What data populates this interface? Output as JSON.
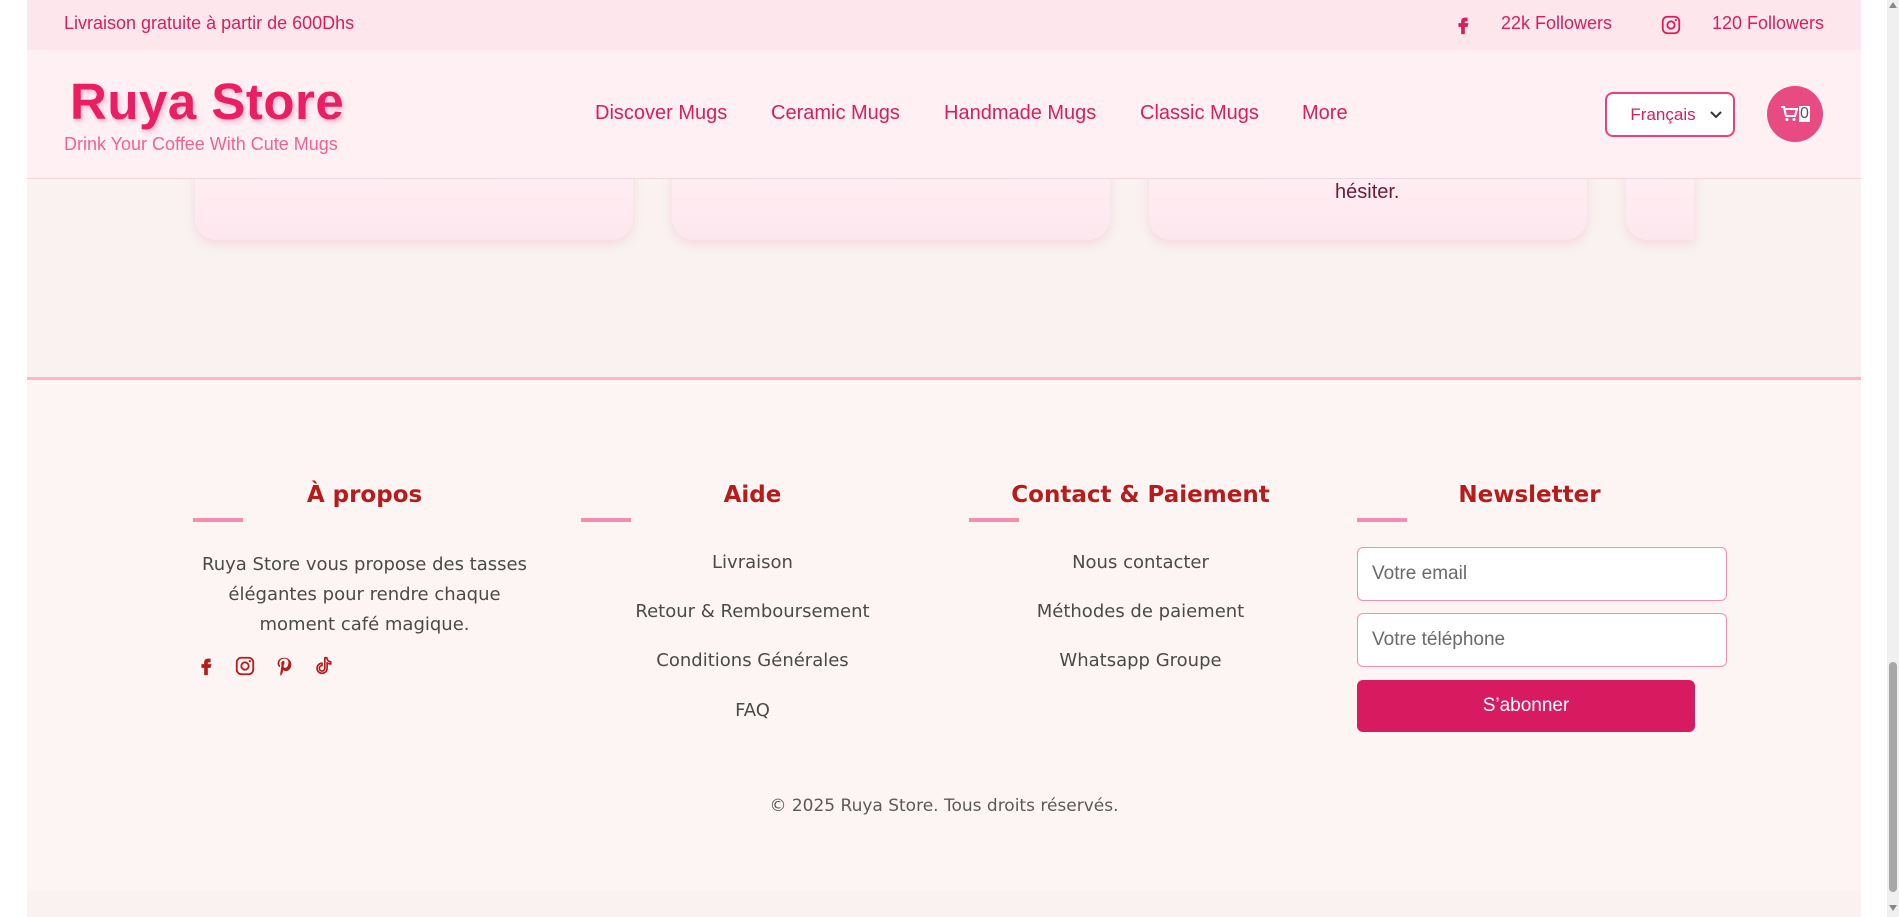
{
  "topbar": {
    "promo": "Livraison gratuite à partir de 600Dhs",
    "facebook_followers": "22k Followers",
    "instagram_followers": "120 Followers",
    "facebook_icon": "facebook-icon",
    "instagram_icon": "instagram-icon"
  },
  "header": {
    "logo_title": "Ruya Store",
    "logo_tagline": "Drink Your Coffee With Cute Mugs",
    "nav": [
      "Discover Mugs",
      "Ceramic Mugs",
      "Handmade Mugs",
      "Classic Mugs",
      "More"
    ],
    "language_selected": "Français",
    "cart_count": "0",
    "cart_icon": "cart-icon"
  },
  "cards": {
    "visible_text": "hésiter."
  },
  "footer": {
    "about": {
      "title": "À propos",
      "text": "Ruya Store vous propose des tasses élégantes pour rendre chaque moment café magique.",
      "social_icons": [
        "facebook-icon",
        "instagram-icon",
        "pinterest-icon",
        "tiktok-icon"
      ]
    },
    "help": {
      "title": "Aide",
      "links": [
        "Livraison",
        "Retour & Remboursement",
        "Conditions Générales",
        "FAQ"
      ]
    },
    "contact": {
      "title": "Contact & Paiement",
      "links": [
        "Nous contacter",
        "Méthodes de paiement",
        "Whatsapp Groupe"
      ]
    },
    "newsletter": {
      "title": "Newsletter",
      "email_placeholder": "Votre email",
      "phone_placeholder": "Votre téléphone",
      "button": "S’abonner"
    },
    "copyright": "© 2025 Ruya Store. Tous droits réservés."
  },
  "colors": {
    "brand_pink": "#e91e63",
    "button_pink": "#d81b60",
    "footer_title_red": "#b71c1c",
    "accent_bar": "#f48fb1"
  }
}
